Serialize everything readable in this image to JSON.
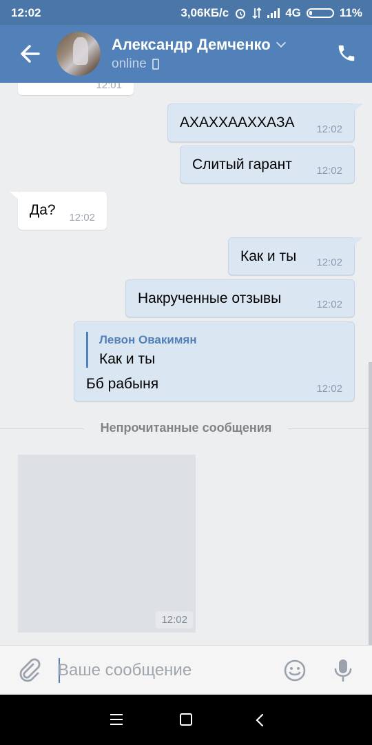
{
  "status": {
    "time": "12:02",
    "net_speed": "3,06КБ/с",
    "network": "4G",
    "battery": "11%"
  },
  "header": {
    "contact_name": "Александр Демченко",
    "presence": "online"
  },
  "messages": [
    {
      "id": "m0",
      "side": "in",
      "text": "",
      "time": "12:01"
    },
    {
      "id": "m1",
      "side": "out",
      "text": "АХАХХААХХАЗА",
      "time": "12:02"
    },
    {
      "id": "m2",
      "side": "out",
      "text": "Слитый гарант",
      "time": "12:02"
    },
    {
      "id": "m3",
      "side": "in",
      "text": "Да?",
      "time": "12:02"
    },
    {
      "id": "m4",
      "side": "out",
      "text": "Как и ты",
      "time": "12:02"
    },
    {
      "id": "m5",
      "side": "out",
      "text": "Накрученные отзывы",
      "time": "12:02"
    },
    {
      "id": "m6",
      "side": "out",
      "reply_author": "Левон Овакимян",
      "reply_text": "Как и ты",
      "text": "Бб рабыня",
      "time": "12:02"
    }
  ],
  "unread_divider": "Непрочитанные сообщения",
  "photo_message": {
    "time": "12:02"
  },
  "composer": {
    "placeholder": "Ваше сообщение",
    "value": ""
  },
  "icons": {
    "back": "arrow-left-icon",
    "call": "phone-icon",
    "attach": "paperclip-icon",
    "emoji": "smile-icon",
    "voice": "microphone-icon"
  },
  "colors": {
    "header": "#5181b8",
    "statusbar": "#4a76a8",
    "outgoing_bubble": "#dbe6f3",
    "incoming_bubble": "#ffffff",
    "chat_bg": "#edeef0"
  }
}
